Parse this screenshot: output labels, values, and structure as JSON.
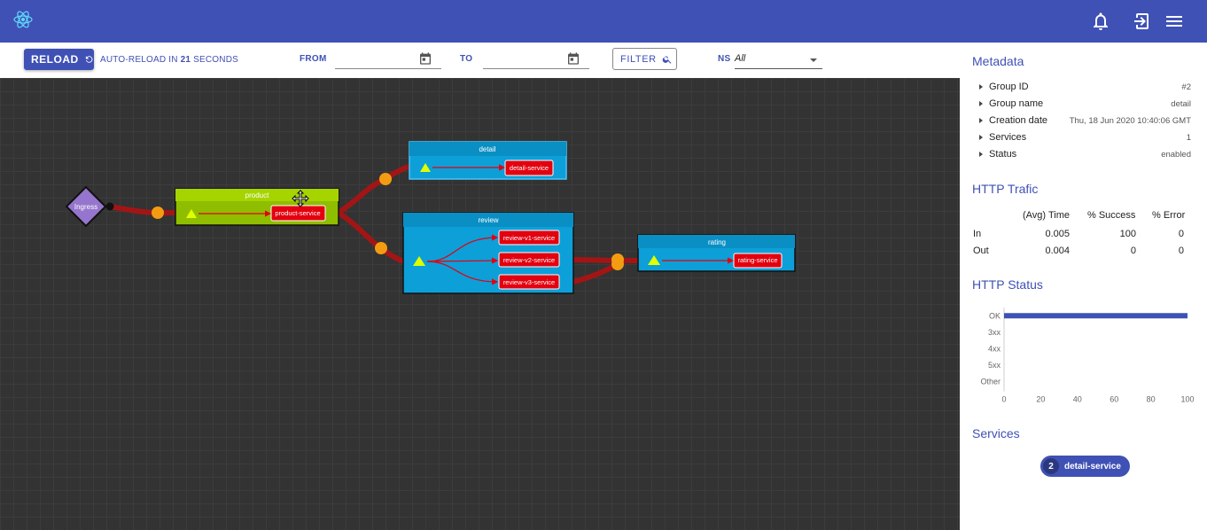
{
  "toolbar": {
    "reload_label": "RELOAD",
    "autoreload_prefix": "AUTO-RELOAD IN",
    "autoreload_seconds": "21",
    "autoreload_suffix": "SECONDS",
    "from_label": "FROM",
    "to_label": "TO",
    "filter_label": "FILTER",
    "ns_label": "NS",
    "ns_value": "All"
  },
  "graph": {
    "ingress": "Ingress",
    "groups": [
      {
        "title": "product",
        "services": [
          "product-service"
        ]
      },
      {
        "title": "detail",
        "services": [
          "detail-service"
        ]
      },
      {
        "title": "review",
        "services": [
          "review-v1-service",
          "review-v2-service",
          "review-v3-service"
        ]
      },
      {
        "title": "rating",
        "services": [
          "rating-service"
        ]
      }
    ]
  },
  "panel": {
    "metadata_title": "Metadata",
    "metadata": [
      {
        "key": "Group ID",
        "value": "#2"
      },
      {
        "key": "Group name",
        "value": "detail"
      },
      {
        "key": "Creation date",
        "value": "Thu, 18 Jun 2020 10:40:06 GMT"
      },
      {
        "key": "Services",
        "value": "1"
      },
      {
        "key": "Status",
        "value": "enabled"
      }
    ],
    "traffic_title": "HTTP Trafic",
    "traffic_headers": [
      "(Avg) Time",
      "% Success",
      "% Error"
    ],
    "traffic_rows": [
      {
        "label": "In",
        "time": "0.005",
        "success": "100",
        "error": "0"
      },
      {
        "label": "Out",
        "time": "0.004",
        "success": "0",
        "error": "0"
      }
    ],
    "status_title": "HTTP Status",
    "services_title": "Services",
    "service_chip": {
      "count": "2",
      "name": "detail-service"
    }
  },
  "chart_data": {
    "type": "bar",
    "orientation": "horizontal",
    "categories": [
      "OK",
      "3xx",
      "4xx",
      "5xx",
      "Other"
    ],
    "values": [
      100,
      0,
      0,
      0,
      0
    ],
    "xlim": [
      0,
      100
    ],
    "xticks": [
      "0",
      "20",
      "40",
      "60",
      "80",
      "100"
    ],
    "color": "#3f51b5"
  },
  "colors": {
    "primary": "#3f51b5",
    "product": "#8fbe00",
    "group_blue": "#0d9fd8",
    "service_red": "#e3000f",
    "edge": "#a31515",
    "port": "#f39c12"
  }
}
